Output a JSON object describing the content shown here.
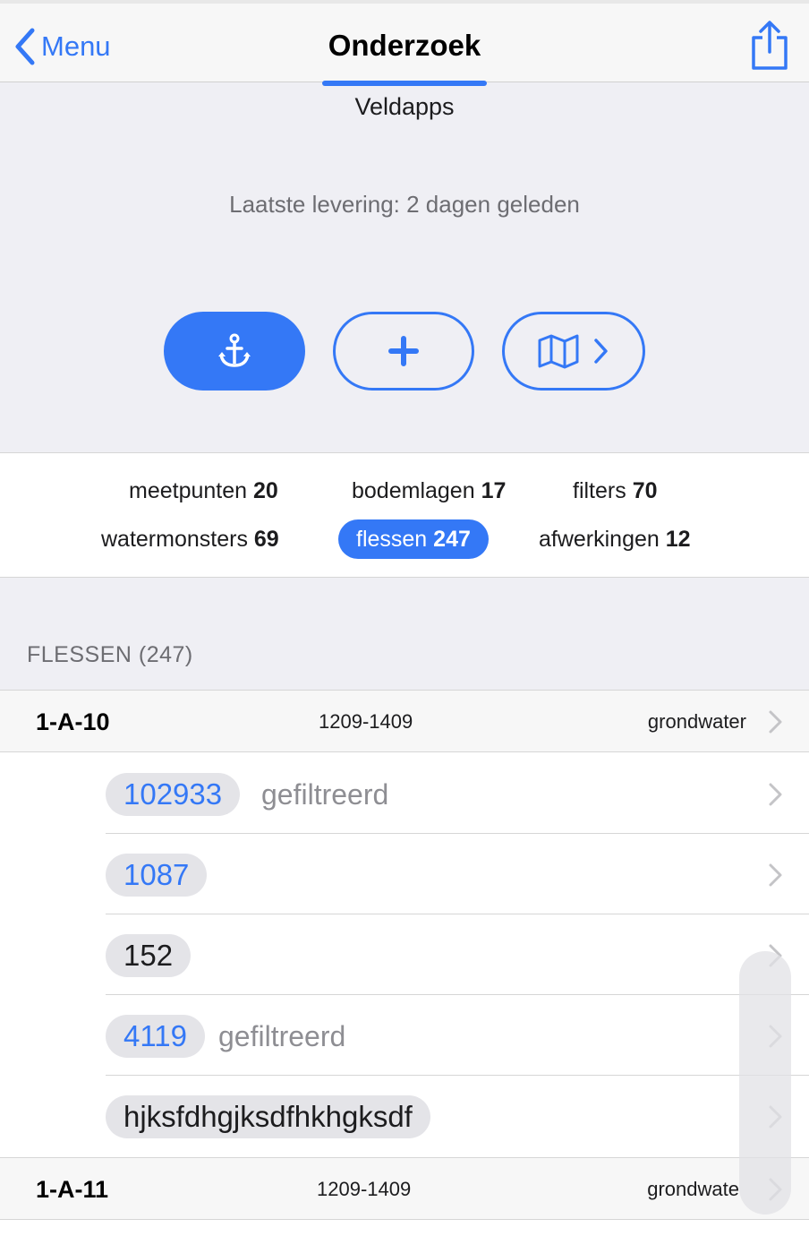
{
  "navbar": {
    "back_label": "Menu",
    "title": "Onderzoek"
  },
  "hero": {
    "app_label": "Veldapps",
    "status": "Laatste levering: 2 dagen geleden",
    "accent": "#3478f6"
  },
  "tabs": [
    {
      "label": "meetpunten",
      "count": "20",
      "active": false
    },
    {
      "label": "bodemlagen",
      "count": "17",
      "active": false
    },
    {
      "label": "filters",
      "count": "70",
      "active": false
    },
    {
      "label": "watermonsters",
      "count": "69",
      "active": false
    },
    {
      "label": "flessen",
      "count": "247",
      "active": true
    },
    {
      "label": "afwerkingen",
      "count": "12",
      "active": false
    }
  ],
  "section": {
    "header": "FLESSEN (247)"
  },
  "groups": [
    {
      "id": "1-A-10",
      "date": "1209-1409",
      "type": "grondwater"
    },
    {
      "id": "1-A-11",
      "date": "1209-1409",
      "type": "grondwate"
    }
  ],
  "bottles": [
    {
      "code": "102933",
      "note": "gefiltreerd"
    },
    {
      "code": "1087",
      "note": ""
    },
    {
      "code": "152",
      "note": ""
    },
    {
      "code": "4119",
      "note": "gefiltreerd"
    },
    {
      "code": "hjksfdhgjksdfhkhgksdf",
      "note": ""
    }
  ],
  "icons": [
    "chevron-left-icon",
    "share-icon",
    "anchor-icon",
    "plus-icon",
    "map-icon",
    "chevron-right-icon"
  ]
}
